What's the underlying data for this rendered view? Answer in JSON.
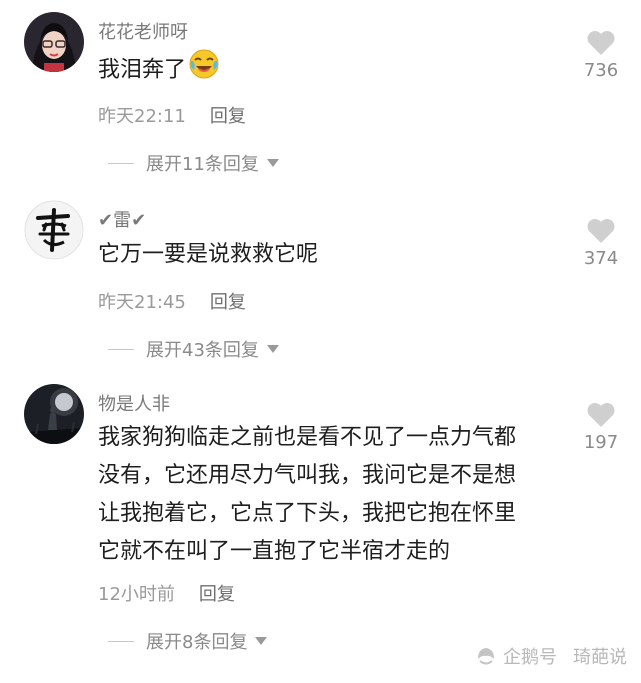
{
  "comments": [
    {
      "username": "花花老师呀",
      "text": "我泪奔了",
      "emoji": "crying-laughing-emoji",
      "time": "昨天22:11",
      "reply_label": "回复",
      "expand_label": "展开11条回复",
      "likes": "736"
    },
    {
      "username": "✔雷✔",
      "text": "它万一要是说救救它呢",
      "time": "昨天21:45",
      "reply_label": "回复",
      "expand_label": "展开43条回复",
      "likes": "374"
    },
    {
      "username": "物是人非",
      "lines": [
        "我家狗狗临走之前也是看不见了一点力气都",
        "没有，它还用尽力气叫我，我问它是不是想",
        "让我抱着它，它点了下头，我把它抱在怀里",
        "它就不在叫了一直抱了它半宿才走的"
      ],
      "time": "12小时前",
      "reply_label": "回复",
      "expand_label": "展开8条回复",
      "likes": "197"
    }
  ],
  "watermark": {
    "source": "企鹅号",
    "author": "琦葩说"
  },
  "colors": {
    "background": "#ffffff",
    "heart": "#cfcfcf",
    "meta": "#9a9a9a"
  }
}
